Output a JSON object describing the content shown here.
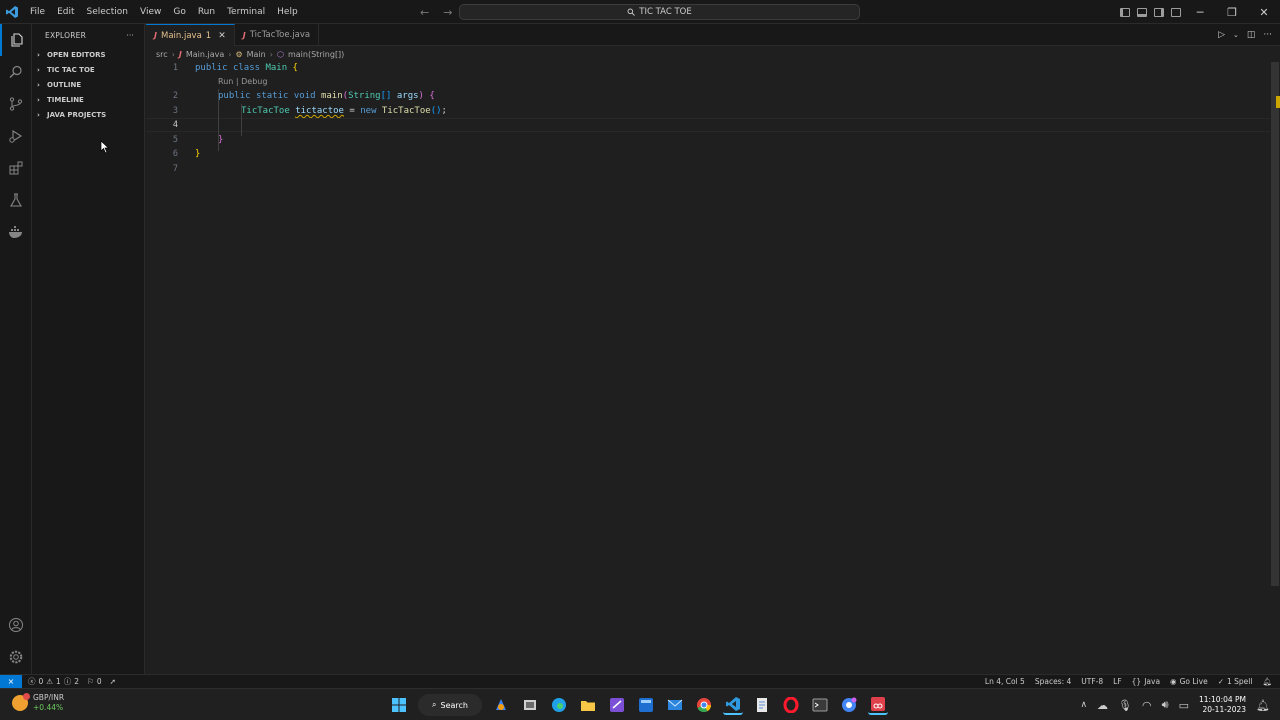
{
  "titlebar": {
    "menu": [
      "File",
      "Edit",
      "Selection",
      "View",
      "Go",
      "Run",
      "Terminal",
      "Help"
    ],
    "command_center": "TIC TAC TOE"
  },
  "sidebar": {
    "title": "EXPLORER",
    "more": "···",
    "sections": [
      "OPEN EDITORS",
      "TIC TAC TOE",
      "OUTLINE",
      "TIMELINE",
      "JAVA PROJECTS"
    ]
  },
  "tabs": [
    {
      "icon": "J",
      "label": "Main.java",
      "badge": "1",
      "active": true
    },
    {
      "icon": "J",
      "label": "TicTacToe.java",
      "badge": "",
      "active": false
    }
  ],
  "breadcrumb": {
    "folder": "src",
    "file": "Main.java",
    "class": "Main",
    "method": "main(String[])"
  },
  "codelens": "Run | Debug",
  "code_lines": [
    {
      "n": "1",
      "tokens": [
        [
          "kw",
          "public "
        ],
        [
          "kw",
          "class "
        ],
        [
          "ty",
          "Main "
        ],
        [
          "br1",
          "{"
        ]
      ]
    },
    {
      "n": "2",
      "tokens": [
        [
          "kw",
          "public "
        ],
        [
          "kw",
          "static "
        ],
        [
          "kw",
          "void "
        ],
        [
          "fn",
          "main"
        ],
        [
          "br2",
          "("
        ],
        [
          "ty",
          "String"
        ],
        [
          "br3",
          "[]"
        ],
        [
          "pl",
          " "
        ],
        [
          "vr",
          "args"
        ],
        [
          "br2",
          ")"
        ],
        [
          "pl",
          " "
        ],
        [
          "br2",
          "{"
        ]
      ]
    },
    {
      "n": "3",
      "tokens": [
        [
          "ty",
          "TicTacToe "
        ],
        [
          "vr sq",
          "tictactoe"
        ],
        [
          "pl",
          " = "
        ],
        [
          "kw",
          "new "
        ],
        [
          "fn",
          "TicTacToe"
        ],
        [
          "br3",
          "()"
        ],
        [
          "pl",
          ";"
        ]
      ]
    },
    {
      "n": "4",
      "tokens": []
    },
    {
      "n": "5",
      "tokens": [
        [
          "br2",
          "}"
        ]
      ]
    },
    {
      "n": "6",
      "tokens": [
        [
          "br1",
          "}"
        ]
      ]
    },
    {
      "n": "7",
      "tokens": []
    }
  ],
  "statusbar": {
    "errors": "0",
    "warnings": "1",
    "infos": "2",
    "ports": "0",
    "position": "Ln 4, Col 5",
    "spaces": "Spaces: 4",
    "encoding": "UTF-8",
    "eol": "LF",
    "language": "Java",
    "golive": "Go Live",
    "spell": "1 Spell"
  },
  "taskbar": {
    "weather_title": "GBP/INR",
    "weather_change": "+0.44%",
    "search": "Search",
    "time": "11:10:04 PM",
    "date": "20-11-2023"
  },
  "colors": {
    "accent": "#0078d4",
    "background": "#1f1f1f",
    "warning": "#cca700"
  }
}
